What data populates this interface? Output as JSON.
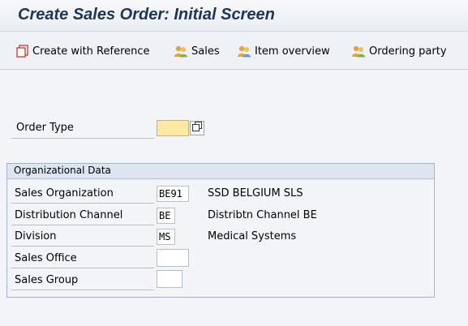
{
  "screen": {
    "title": "Create Sales Order: Initial Screen"
  },
  "toolbar": {
    "buttons": [
      {
        "label": "Create with Reference",
        "icon": "create-with-reference-icon"
      },
      {
        "label": "Sales",
        "icon": "sales-icon"
      },
      {
        "label": "Item overview",
        "icon": "item-overview-icon"
      },
      {
        "label": "Ordering party",
        "icon": "ordering-party-icon"
      }
    ]
  },
  "order_type": {
    "label": "Order Type",
    "value": "",
    "help_icon": "value-help-icon"
  },
  "org_data": {
    "title": "Organizational Data",
    "fields": [
      {
        "label": "Sales Organization",
        "value": "BE91",
        "description": "SSD BELGIUM SLS"
      },
      {
        "label": "Distribution Channel",
        "value": "BE",
        "description": "Distribtn Channel BE"
      },
      {
        "label": "Division",
        "value": "MS",
        "description": "Medical Systems"
      },
      {
        "label": "Sales Office",
        "value": "",
        "description": ""
      },
      {
        "label": "Sales Group",
        "value": "",
        "description": ""
      }
    ]
  },
  "colors": {
    "title": "#1d3557",
    "required_field": "#fde8a4",
    "group_header": "#dde6f0"
  }
}
